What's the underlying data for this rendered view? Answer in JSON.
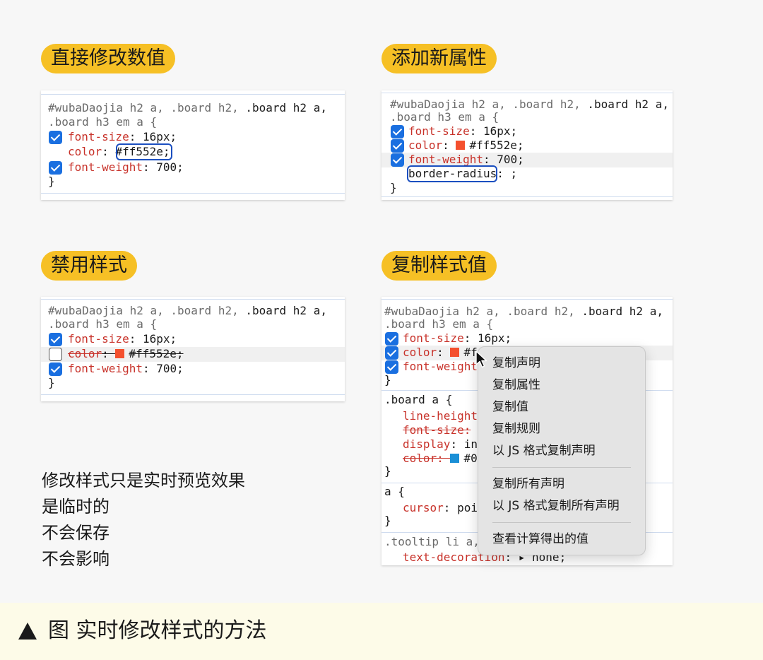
{
  "titles": {
    "edit": "直接修改数值",
    "add": "添加新属性",
    "disable": "禁用样式",
    "copy": "复制样式值"
  },
  "selector": {
    "muted1": "#wubaDaojia h2 a, .board h2, ",
    "strong": ".board h2 a,",
    "line2": ".board h3 em a {"
  },
  "code": {
    "font_size_prop": "font-size",
    "font_size_val": ": 16px;",
    "color_prop": "color",
    "color_sep": ": ",
    "color_val": "#ff552e",
    "semicolon": ";",
    "font_weight_prop": "font-weight",
    "font_weight_val": ": 700;",
    "close": "}",
    "new_prop": "border-radius",
    "new_rest": ": ;",
    "swatch_color": "#f4502e"
  },
  "copy_panel": {
    "color_partial": "#f",
    "font_weight_prop": "font-weight",
    "board_a": ".board a {",
    "line_height": "line-height",
    "font_size_struck": "font-size: ",
    "display": "display",
    "display_val": ": in",
    "color_struck": "color: ",
    "color2_val": "#0",
    "color2_swatch": "#1a8fd6",
    "a_rule": "a {",
    "cursor_prop": "cursor",
    "cursor_val": ": poi",
    "tooltip": ".tooltip li a,",
    "text_decoration": "text-decoration",
    "text_decoration_val": ": ▸ none;"
  },
  "context_menu": {
    "items": [
      "复制声明",
      "复制属性",
      "复制值",
      "复制规则",
      "以 JS 格式复制声明"
    ],
    "items2": [
      "复制所有声明",
      "以 JS 格式复制所有声明"
    ],
    "items3": [
      "查看计算得出的值"
    ]
  },
  "note": [
    "修改样式只是实时预览效果",
    "是临时的",
    "不会保存",
    "不会影响"
  ],
  "caption": "图  实时修改样式的方法",
  "colors": {
    "accent": "#f6c025",
    "checkbox": "#1a6fe0",
    "property": "#c8322a",
    "highlight": "#1b4fc0"
  }
}
